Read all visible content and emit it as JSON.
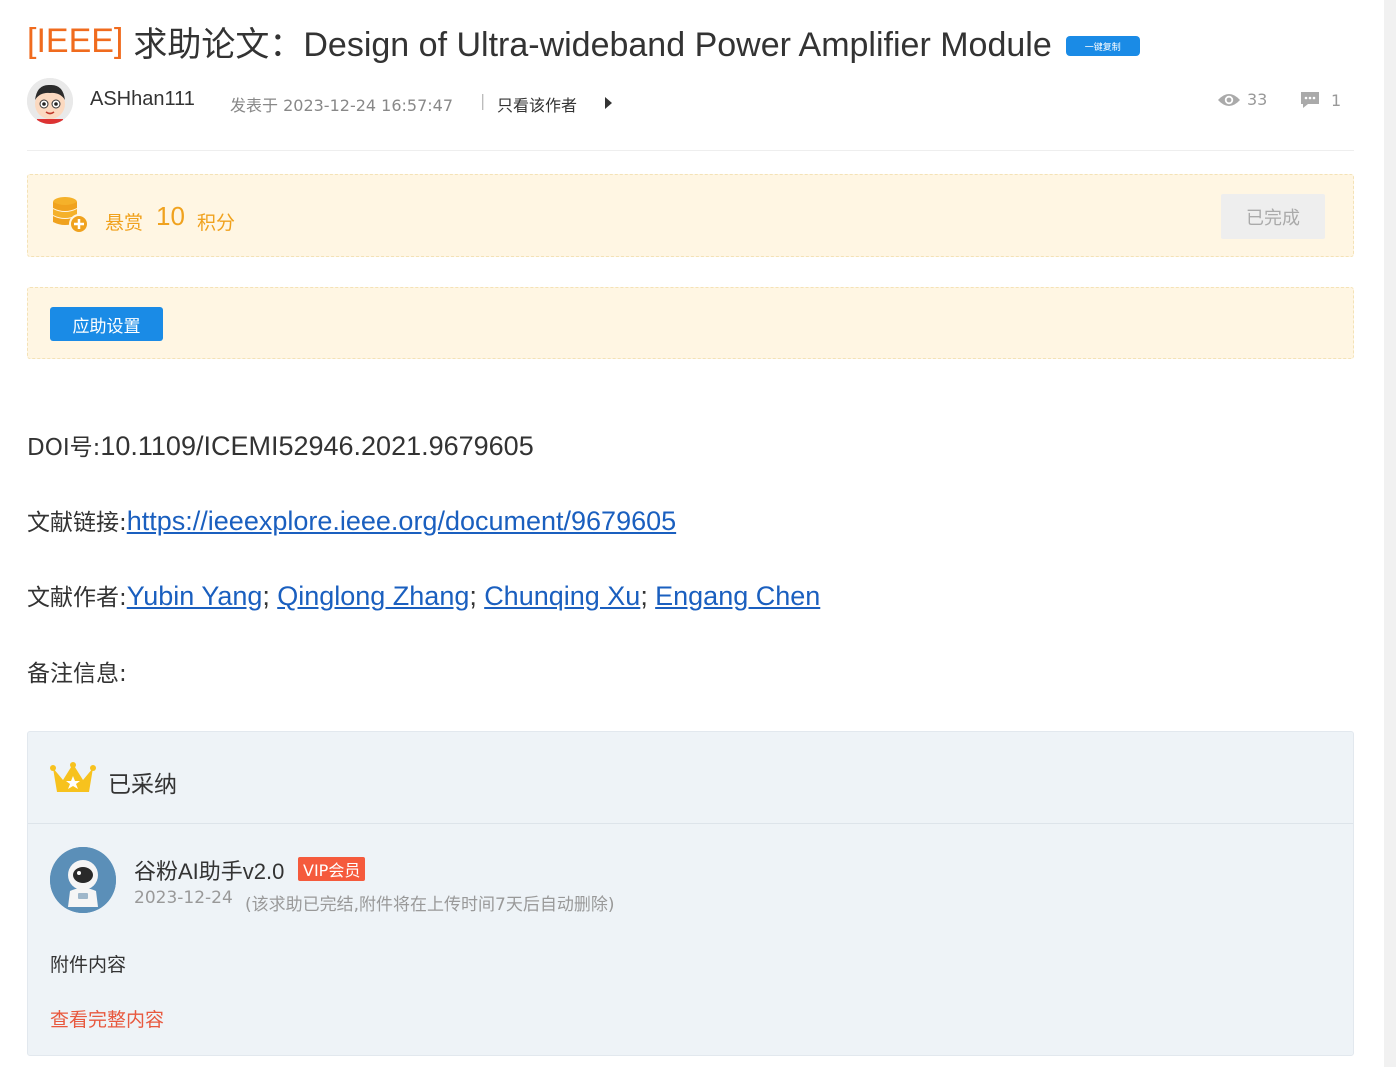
{
  "post": {
    "tag": "[IEEE]",
    "title": "求助论文：Design of Ultra-wideband Power Amplifier Module",
    "copy_button": "一键复制"
  },
  "author": {
    "name": "ASHhan111",
    "posted": "发表于 2023-12-24 16:57:47",
    "separator": "|",
    "only_author": "只看该作者",
    "views": "33",
    "comments": "1"
  },
  "reward": {
    "label": "悬赏",
    "amount": "10",
    "unit": "积分",
    "status": "已完成"
  },
  "settings": {
    "button": "应助设置"
  },
  "paper": {
    "doi_label": "DOI号:",
    "doi_value": "10.1109/ICEMI52946.2021.9679605",
    "link_label": "文献链接:",
    "link_url": "https://ieeexplore.ieee.org/document/9679605",
    "authors_label": "文献作者:",
    "authors": [
      "Yubin Yang",
      "Qinglong Zhang",
      "Chunqing Xu",
      "Engang Chen"
    ],
    "author_separator": ";",
    "notes_label": "备注信息:"
  },
  "adopted": {
    "title": "已采纳",
    "responder": "谷粉AI助手v2.0",
    "badge": "VIP会员",
    "date": "2023-12-24",
    "note": "(该求助已完结,附件将在上传时间7天后自动删除)",
    "attachment_label": "附件内容",
    "view_full": "查看完整内容"
  },
  "colors": {
    "accent_blue": "#1a8be6",
    "reward_orange": "#f0a21e",
    "tag_orange": "#f06b1e",
    "link_blue": "#1a5fbf",
    "vip_red": "#f55a3c"
  }
}
